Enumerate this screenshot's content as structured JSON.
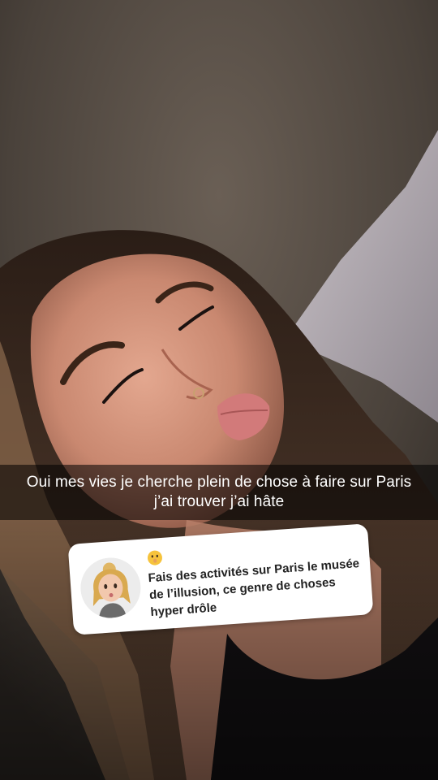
{
  "story": {
    "caption": "Oui mes vies je cherche plein de chose à faire sur Paris j’ai trouver j’ai hâte"
  },
  "reply": {
    "emoji_icon": "shushing-face-emoji",
    "text": "Fais des activités sur Paris le musée de l’illusion, ce genre de choses hyper drôle"
  },
  "colors": {
    "caption_bar": "#000000",
    "card_background": "#ffffff",
    "card_text": "#222222"
  }
}
